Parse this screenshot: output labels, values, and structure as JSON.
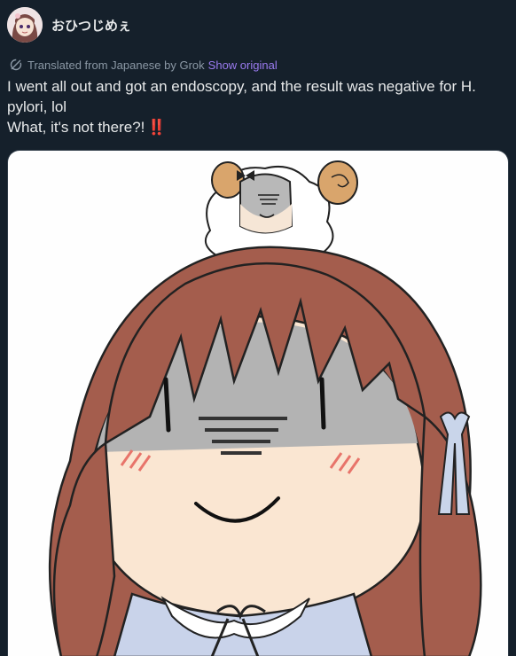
{
  "author": {
    "display_name": "おひつじめぇ",
    "avatar_icon": "avatar-image"
  },
  "translation": {
    "notice": "Translated from Japanese by Grok",
    "show_original_label": "Show original",
    "icon": "translate-icon"
  },
  "tweet": {
    "line1": "I went all out and got an endoscopy, and the result was negative for H. pylori, lol",
    "line2": "What, it's not there?!",
    "emoji": "‼️"
  },
  "media": {
    "type": "illustration",
    "description_icon": "chibi-girl-with-sheep-illustration"
  },
  "colors": {
    "background": "#15202b",
    "text": "#e7e9ea",
    "muted": "#8b98a5",
    "link": "#9b7bf0",
    "accent_red": "#d9253a"
  }
}
